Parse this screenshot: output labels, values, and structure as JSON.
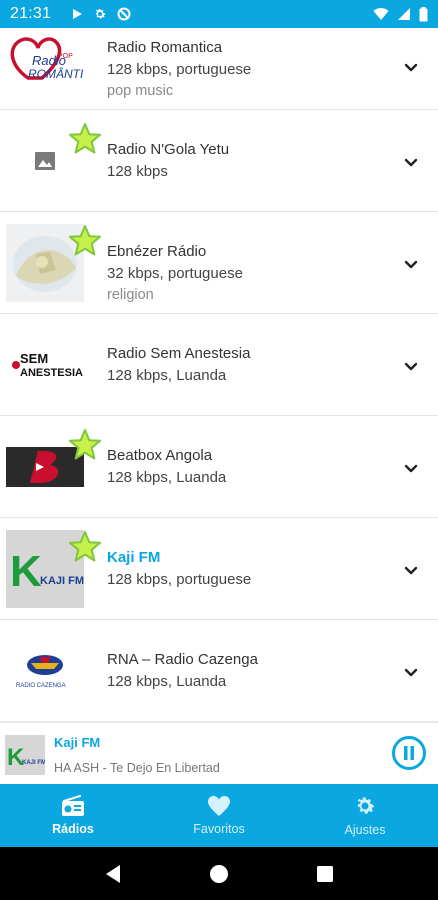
{
  "status_bar": {
    "time": "21:31",
    "icons": [
      "play-icon",
      "gear-icon",
      "no-disturb-icon"
    ],
    "right_icons": [
      "wifi-icon",
      "signal-icon",
      "battery-icon"
    ]
  },
  "stations": [
    {
      "name": "Radio Romantica",
      "detail": "128 kbps, portuguese",
      "genre": "pop music",
      "favorite": false,
      "logo": "radio-romantica-logo",
      "active": false
    },
    {
      "name": "Radio N'Gola Yetu",
      "detail": "128 kbps",
      "genre": "",
      "favorite": true,
      "logo": "image-placeholder-icon",
      "active": false
    },
    {
      "name": "Ebnézer Rádio",
      "detail": "32 kbps, portuguese",
      "genre": "religion",
      "favorite": true,
      "logo": "ebnezer-logo",
      "active": false
    },
    {
      "name": "Radio Sem Anestesia",
      "detail": "128 kbps, Luanda",
      "genre": "",
      "favorite": false,
      "logo": "sem-anestesia-logo",
      "active": false
    },
    {
      "name": "Beatbox Angola",
      "detail": "128 kbps, Luanda",
      "genre": "",
      "favorite": true,
      "logo": "beatbox-logo",
      "active": false
    },
    {
      "name": "Kaji FM",
      "detail": "128 kbps, portuguese",
      "genre": "",
      "favorite": true,
      "logo": "kaji-fm-logo",
      "active": true
    },
    {
      "name": "RNA – Radio Cazenga",
      "detail": "128 kbps, Luanda",
      "genre": "",
      "favorite": false,
      "logo": "rna-logo",
      "active": false
    }
  ],
  "player": {
    "station": "Kaji FM",
    "song": "HA ASH - Te Dejo En Libertad"
  },
  "bottom_nav": [
    {
      "label": "Rádios",
      "icon": "radio-icon",
      "active": true
    },
    {
      "label": "Favoritos",
      "icon": "heart-icon",
      "active": false
    },
    {
      "label": "Ajustes",
      "icon": "gear-icon",
      "active": false
    }
  ],
  "colors": {
    "accent": "#0aa7e0",
    "star_fill": "#c8f04a",
    "star_stroke": "#7ec63a"
  }
}
